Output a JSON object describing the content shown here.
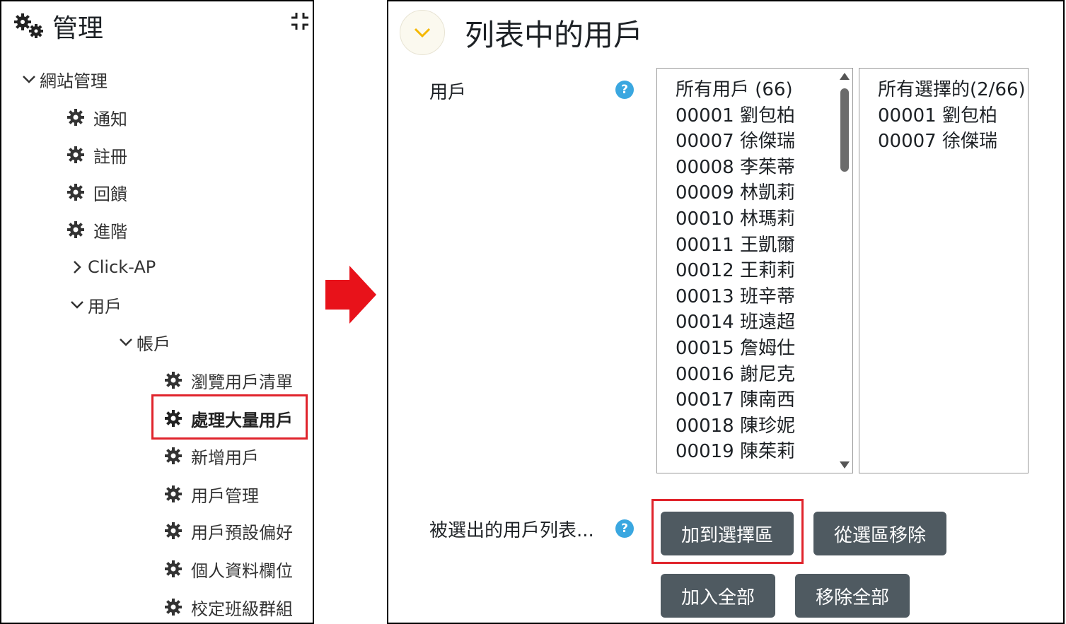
{
  "admin": {
    "title": "管理",
    "tree": {
      "site_admin": "網站管理",
      "notifications": "通知",
      "registration": "註冊",
      "feedback": "回饋",
      "advanced": "進階",
      "click_ap": "Click-AP",
      "users": "用戶",
      "accounts": "帳戶",
      "account_items": [
        "瀏覽用戶清單",
        "處理大量用戶",
        "新增用戶",
        "用戶管理",
        "用戶預設偏好",
        "個人資料欄位",
        "校定班級群組"
      ],
      "selected_item": "處理大量用戶"
    }
  },
  "section": {
    "title": "列表中的用戶",
    "users_label": "用戶",
    "selected_list_label": "被選出的用戶列表...",
    "help_glyph": "?"
  },
  "available_users": {
    "header": "所有用戶 (66)",
    "items": [
      "00001 劉包柏",
      "00007 徐傑瑞",
      "00008 李茱蒂",
      "00009 林凱莉",
      "00010 林瑪莉",
      "00011 王凱爾",
      "00012 王莉莉",
      "00013 班辛蒂",
      "00014 班遠超",
      "00015 詹姆仕",
      "00016 謝尼克",
      "00017 陳南西",
      "00018 陳珍妮",
      "00019 陳茱莉"
    ]
  },
  "selected_users": {
    "header": "所有選擇的(2/66)",
    "items": [
      "00001 劉包柏",
      "00007 徐傑瑞"
    ]
  },
  "buttons": {
    "add_to_selection": "加到選擇區",
    "remove_from_selection": "從選區移除",
    "add_all": "加入全部",
    "remove_all": "移除全部"
  },
  "colors": {
    "highlight": "#e0242c",
    "button_bg": "#4f5a61",
    "help_icon": "#3aa7e0",
    "arrow": "#e8121a"
  }
}
